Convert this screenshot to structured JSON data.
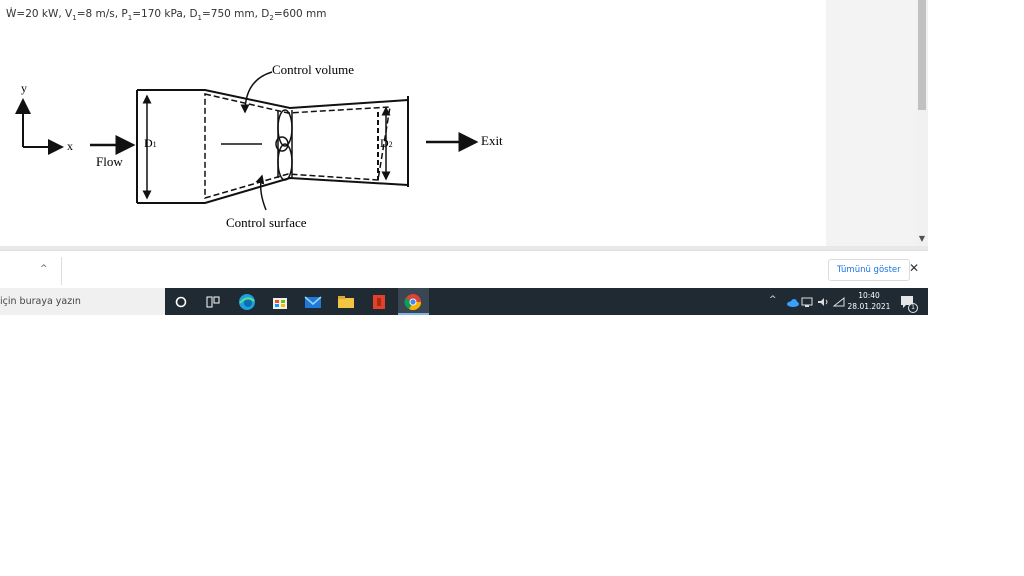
{
  "problem": {
    "w_symbol": "Ẇ",
    "w_value": "=20 kW, V",
    "v_sub": "1",
    "v_value": "=8 m/s, P",
    "p_sub": "1",
    "p_value": "=170 kPa, D",
    "d1_sub": "1",
    "d1_value": "=750 mm, D",
    "d2_sub": "2",
    "d2_value": "=600 mm"
  },
  "diagram": {
    "axis_y": "y",
    "axis_x": "x",
    "flow": "Flow",
    "d1": "D",
    "d1_sub": "1",
    "d2": "D",
    "d2_sub": "2",
    "control_volume": "Control volume",
    "control_surface": "Control surface",
    "exit": "Exit"
  },
  "download_bar": {
    "show_all": "Tümünü göster",
    "close_symbol": "✕",
    "chevron": "^"
  },
  "taskbar": {
    "search_text": "için buraya yazın",
    "time": "10:40",
    "date": "28.01.2021",
    "notification_count": "1"
  },
  "colors": {
    "taskbar_bg": "#202a33",
    "accent": "#1a73e8"
  }
}
